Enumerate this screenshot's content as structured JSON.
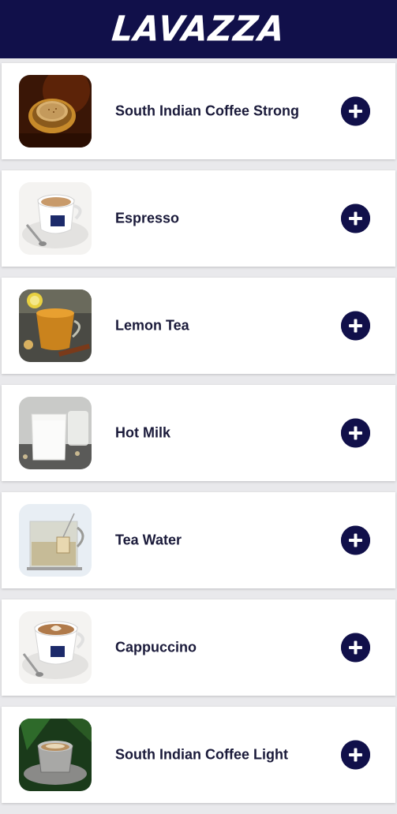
{
  "header": {
    "brand": "LAVAZZA",
    "background": "#11104a"
  },
  "menu": {
    "items": [
      {
        "name": "South Indian Coffee Strong",
        "image": "south-indian-coffee-strong-image"
      },
      {
        "name": "Espresso",
        "image": "espresso-image"
      },
      {
        "name": "Lemon Tea",
        "image": "lemon-tea-image"
      },
      {
        "name": "Hot Milk",
        "image": "hot-milk-image"
      },
      {
        "name": "Tea Water",
        "image": "tea-water-image"
      },
      {
        "name": "Cappuccino",
        "image": "cappuccino-image"
      },
      {
        "name": "South Indian Coffee Light",
        "image": "south-indian-coffee-light-image"
      }
    ],
    "add_icon": "plus-circle-icon"
  }
}
